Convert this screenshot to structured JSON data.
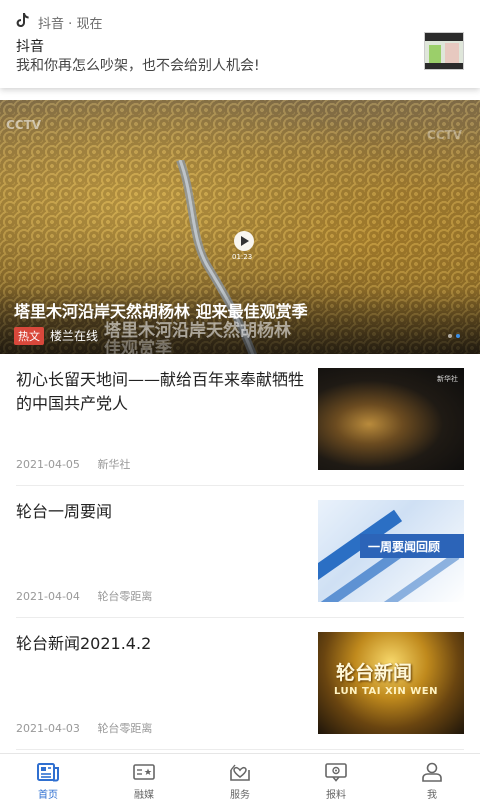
{
  "notification": {
    "app_name": "抖音",
    "time": "现在",
    "separator": "·",
    "title": "抖音",
    "text": "我和你再怎么吵架，也不会给别人机会!"
  },
  "hero": {
    "watermark": "CCTV",
    "title": "塔里木河沿岸天然胡杨林 迎来最佳观赏季",
    "ghost_title": "塔里木河沿岸天然胡杨林",
    "ghost_subtitle": "佳观赏季",
    "badge": "热文",
    "source": "楼兰在线",
    "duration": "01:23",
    "active_dot": 2,
    "dot_count": 2
  },
  "news": [
    {
      "title": "初心长留天地间——献给百年来奉献牺牲的中国共产党人",
      "date": "2021-04-05",
      "source": "新华社",
      "thumb_logo": "新华社"
    },
    {
      "title": "轮台一周要闻",
      "date": "2021-04-04",
      "source": "轮台零距离",
      "thumb_text": "一周要闻回顾"
    },
    {
      "title": "轮台新闻2021.4.2",
      "date": "2021-04-03",
      "source": "轮台零距离",
      "thumb_text": "轮台新闻",
      "thumb_subtext": "LUN TAI XIN WEN"
    }
  ],
  "bottom_nav": [
    {
      "label": "首页",
      "icon": "news-icon",
      "active": true
    },
    {
      "label": "融媒",
      "icon": "media-icon",
      "active": false
    },
    {
      "label": "服务",
      "icon": "service-icon",
      "active": false
    },
    {
      "label": "报料",
      "icon": "report-icon",
      "active": false
    },
    {
      "label": "我",
      "icon": "user-icon",
      "active": false
    }
  ],
  "colors": {
    "accent": "#2f6fd0",
    "badge": "#d9483b"
  }
}
